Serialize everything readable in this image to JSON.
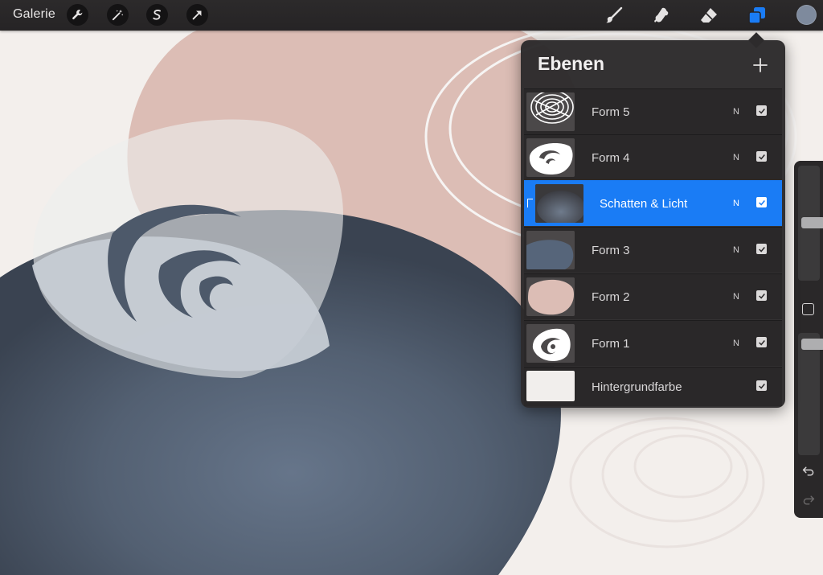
{
  "app": {
    "gallery_label": "Galerie"
  },
  "toolbar": {
    "left_tools": [
      "wrench-icon",
      "magic-wand-icon",
      "selection-s-icon",
      "transform-arrow-icon"
    ],
    "right_tools": [
      "brush-icon",
      "smudge-icon",
      "eraser-icon",
      "layers-icon"
    ],
    "active_tool": "layers-icon",
    "color_swatch": "#7e8a9d",
    "active_color": "#1a7cf5"
  },
  "layers_panel": {
    "title": "Ebenen",
    "add_icon": "plus-icon",
    "layers": [
      {
        "name": "Form 5",
        "blend": "N",
        "visible": true,
        "selected": false
      },
      {
        "name": "Form 4",
        "blend": "N",
        "visible": true,
        "selected": false
      },
      {
        "name": "Schatten & Licht",
        "blend": "N",
        "visible": true,
        "selected": true,
        "clipping_mask": true
      },
      {
        "name": "Form 3",
        "blend": "N",
        "visible": true,
        "selected": false
      },
      {
        "name": "Form 2",
        "blend": "N",
        "visible": true,
        "selected": false
      },
      {
        "name": "Form 1",
        "blend": "N",
        "visible": true,
        "selected": false
      },
      {
        "name": "Hintergrundfarbe",
        "blend": "",
        "visible": true,
        "selected": false
      }
    ]
  },
  "sidebar": {
    "brush_size_level": 0.51,
    "opacity_level": 0.14,
    "icons": [
      "modify-square-icon",
      "undo-icon",
      "redo-icon"
    ]
  },
  "canvas_colors": {
    "background": "#f3efec",
    "pink_shape": "#dcbdb5",
    "dark_shape": "#4a5566",
    "light_overlay": "#eceeef"
  }
}
